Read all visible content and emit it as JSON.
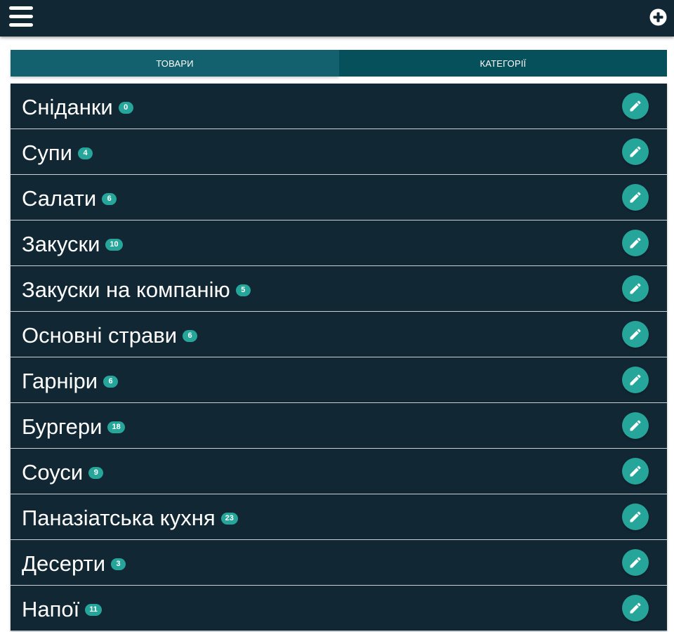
{
  "header": {
    "menu_icon": "hamburger-menu-icon",
    "add_icon": "plus-circle-icon"
  },
  "tabs": [
    {
      "label": "ТОВАРИ",
      "active": true
    },
    {
      "label": "КАТЕГОРІЇ",
      "active": false
    }
  ],
  "colors": {
    "topbar": "#122734",
    "tab_active": "#13616f",
    "tab_inactive": "#06505c",
    "list_bg": "#122734",
    "accent": "#26a69a"
  },
  "categories": [
    {
      "name": "Сніданки",
      "count": "0"
    },
    {
      "name": "Супи",
      "count": "4"
    },
    {
      "name": "Салати",
      "count": "6"
    },
    {
      "name": "Закуски",
      "count": "10"
    },
    {
      "name": "Закуски на компанію",
      "count": "5"
    },
    {
      "name": "Основні страви",
      "count": "6"
    },
    {
      "name": "Гарніри",
      "count": "6"
    },
    {
      "name": "Бургери",
      "count": "18"
    },
    {
      "name": "Соуси",
      "count": "9"
    },
    {
      "name": "Паназіатська кухня",
      "count": "23"
    },
    {
      "name": "Десерти",
      "count": "3"
    },
    {
      "name": "Напої",
      "count": "11"
    }
  ],
  "row_action_icon": "pencil-icon"
}
